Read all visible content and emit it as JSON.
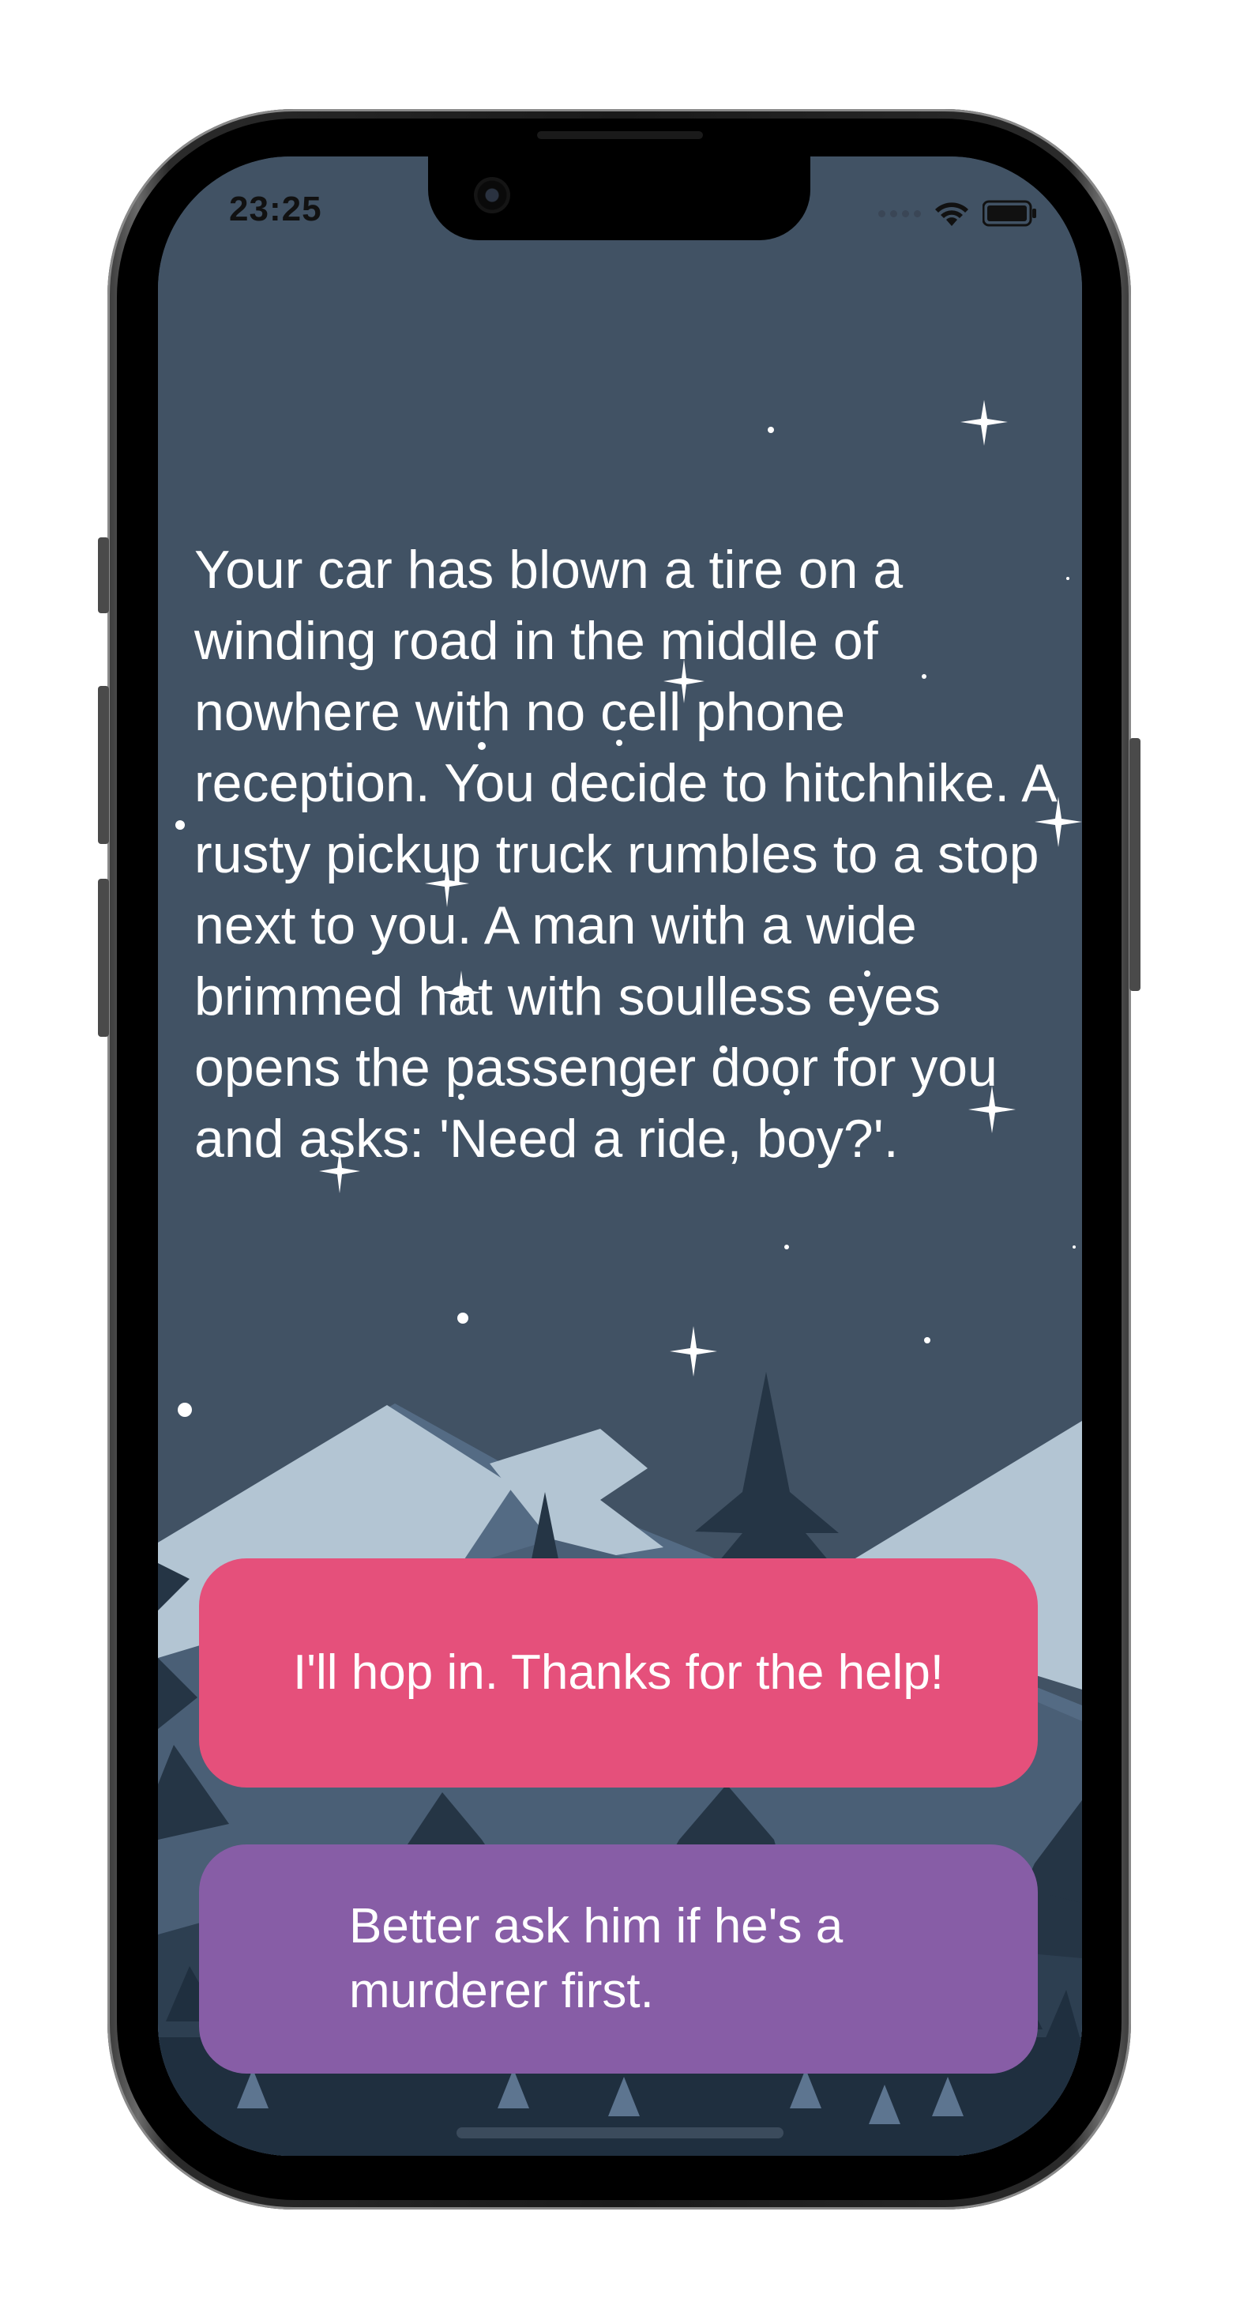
{
  "status_bar": {
    "time": "23:25",
    "signal_icon": "cellular-signal-icon",
    "wifi_icon": "wifi-icon",
    "battery_icon": "battery-icon"
  },
  "story": {
    "text": "Your car has blown a tire on a winding road in the middle of nowhere with no cell phone reception. You decide to hitchhike. A rusty pickup truck rumbles to a stop next to you. A man with a wide brimmed hat with soulless eyes opens the passenger door for you and asks: 'Need a ride, boy?'."
  },
  "choices": [
    {
      "label": "I'll hop in. Thanks for the help!",
      "color": "#e5507b"
    },
    {
      "label": "Better ask him if he's a murderer first.",
      "color": "#875da6"
    }
  ],
  "colors": {
    "sky": "#415264",
    "mountain_light": "#b3c5d3",
    "mountain_mid": "#546b84",
    "tree_dark": "#253545"
  }
}
